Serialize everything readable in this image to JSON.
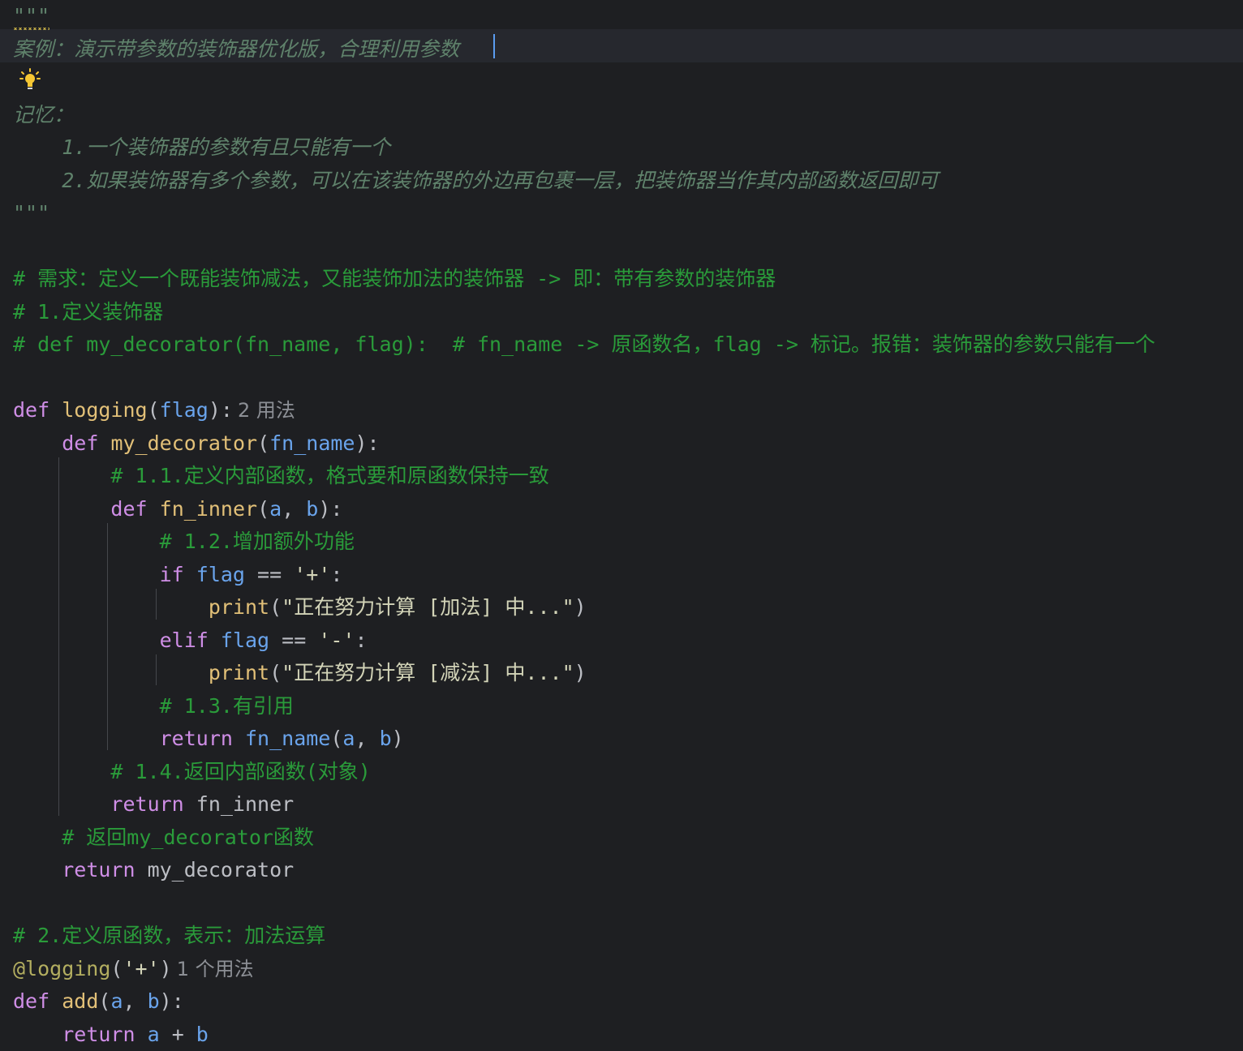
{
  "editor": {
    "lines": [
      [
        {
          "t": "\"\"\"",
          "c": "doc squiggle"
        }
      ],
      [
        {
          "t": "案例：演示带参数的装饰器优化版，合理利用参数",
          "c": "doc"
        }
      ],
      [],
      [
        {
          "t": "记忆：",
          "c": "doc"
        }
      ],
      [
        {
          "t": "    1.一个装饰器的参数有且只能有一个",
          "c": "doc"
        }
      ],
      [
        {
          "t": "    2.如果装饰器有多个参数，可以在该装饰器的外边再包裹一层，把装饰器当作其内部函数返回即可",
          "c": "doc"
        }
      ],
      [
        {
          "t": "\"\"\"",
          "c": "doc"
        }
      ],
      [],
      [
        {
          "t": "# 需求：定义一个既能装饰减法，又能装饰加法的装饰器 -> 即：带有参数的装饰器",
          "c": "cmt"
        }
      ],
      [
        {
          "t": "# 1.定义装饰器",
          "c": "cmt"
        }
      ],
      [
        {
          "t": "# def my_decorator(fn_name, flag):  # fn_name -> 原函数名，flag -> 标记。报错：装饰器的参数只能有一个",
          "c": "cmt"
        }
      ],
      [],
      [
        {
          "t": "def ",
          "c": "kw"
        },
        {
          "t": "logging",
          "c": "fn"
        },
        {
          "t": "(",
          "c": ""
        },
        {
          "t": "flag",
          "c": "prm"
        },
        {
          "t": "):",
          "c": ""
        },
        {
          "t": "2 用法",
          "c": "hint"
        }
      ],
      [
        {
          "t": "    ",
          "c": ""
        },
        {
          "t": "def ",
          "c": "kw"
        },
        {
          "t": "my_decorator",
          "c": "fn"
        },
        {
          "t": "(",
          "c": ""
        },
        {
          "t": "fn_name",
          "c": "prm"
        },
        {
          "t": "):",
          "c": ""
        }
      ],
      [
        {
          "t": "        # 1.1.定义内部函数，格式要和原函数保持一致",
          "c": "cmt"
        }
      ],
      [
        {
          "t": "        ",
          "c": ""
        },
        {
          "t": "def ",
          "c": "kw"
        },
        {
          "t": "fn_inner",
          "c": "fn"
        },
        {
          "t": "(",
          "c": ""
        },
        {
          "t": "a",
          "c": "prm"
        },
        {
          "t": ", ",
          "c": ""
        },
        {
          "t": "b",
          "c": "prm"
        },
        {
          "t": "):",
          "c": ""
        }
      ],
      [
        {
          "t": "            # 1.2.增加额外功能",
          "c": "cmt"
        }
      ],
      [
        {
          "t": "            ",
          "c": ""
        },
        {
          "t": "if ",
          "c": "kw"
        },
        {
          "t": "flag",
          "c": "prm"
        },
        {
          "t": " == ",
          "c": ""
        },
        {
          "t": "'+'",
          "c": "str"
        },
        {
          "t": ":",
          "c": ""
        }
      ],
      [
        {
          "t": "                ",
          "c": ""
        },
        {
          "t": "print",
          "c": "fn"
        },
        {
          "t": "(",
          "c": ""
        },
        {
          "t": "\"正在努力计算 [加法] 中...\"",
          "c": "str"
        },
        {
          "t": ")",
          "c": ""
        }
      ],
      [
        {
          "t": "            ",
          "c": ""
        },
        {
          "t": "elif ",
          "c": "kw"
        },
        {
          "t": "flag",
          "c": "prm"
        },
        {
          "t": " == ",
          "c": ""
        },
        {
          "t": "'-'",
          "c": "str"
        },
        {
          "t": ":",
          "c": ""
        }
      ],
      [
        {
          "t": "                ",
          "c": ""
        },
        {
          "t": "print",
          "c": "fn"
        },
        {
          "t": "(",
          "c": ""
        },
        {
          "t": "\"正在努力计算 [减法] 中...\"",
          "c": "str"
        },
        {
          "t": ")",
          "c": ""
        }
      ],
      [
        {
          "t": "            # 1.3.有引用",
          "c": "cmt"
        }
      ],
      [
        {
          "t": "            ",
          "c": ""
        },
        {
          "t": "return ",
          "c": "kw"
        },
        {
          "t": "fn_name",
          "c": "prm"
        },
        {
          "t": "(",
          "c": ""
        },
        {
          "t": "a",
          "c": "prm"
        },
        {
          "t": ", ",
          "c": ""
        },
        {
          "t": "b",
          "c": "prm"
        },
        {
          "t": ")",
          "c": ""
        }
      ],
      [
        {
          "t": "        # 1.4.返回内部函数(对象)",
          "c": "cmt"
        }
      ],
      [
        {
          "t": "        ",
          "c": ""
        },
        {
          "t": "return ",
          "c": "kw"
        },
        {
          "t": "fn_inner",
          "c": ""
        }
      ],
      [
        {
          "t": "    # 返回my_decorator函数",
          "c": "cmt"
        }
      ],
      [
        {
          "t": "    ",
          "c": ""
        },
        {
          "t": "return ",
          "c": "kw"
        },
        {
          "t": "my_decorator",
          "c": ""
        }
      ],
      [],
      [
        {
          "t": "# 2.定义原函数，表示：加法运算",
          "c": "cmt"
        }
      ],
      [
        {
          "t": "@logging",
          "c": "dec"
        },
        {
          "t": "(",
          "c": ""
        },
        {
          "t": "'+'",
          "c": "str"
        },
        {
          "t": ")",
          "c": ""
        },
        {
          "t": "1 个用法",
          "c": "hint"
        }
      ],
      [
        {
          "t": "def ",
          "c": "kw"
        },
        {
          "t": "add",
          "c": "fn"
        },
        {
          "t": "(",
          "c": ""
        },
        {
          "t": "a",
          "c": "prm"
        },
        {
          "t": ", ",
          "c": ""
        },
        {
          "t": "b",
          "c": "prm"
        },
        {
          "t": "):",
          "c": ""
        }
      ],
      [
        {
          "t": "    ",
          "c": ""
        },
        {
          "t": "return ",
          "c": "kw"
        },
        {
          "t": "a",
          "c": "prm"
        },
        {
          "t": " + ",
          "c": ""
        },
        {
          "t": "b",
          "c": "prm"
        }
      ]
    ]
  }
}
